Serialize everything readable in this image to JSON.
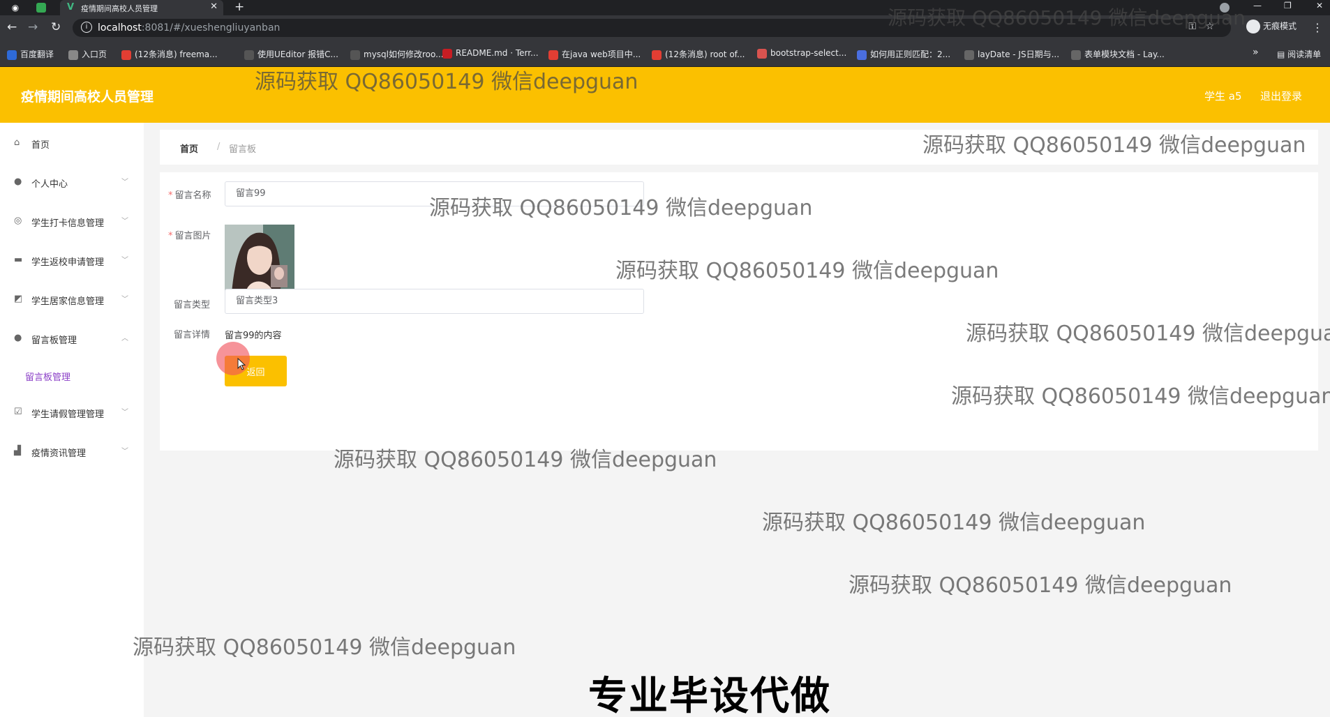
{
  "browser": {
    "tab_title": "疫情期间高校人员管理",
    "url_host": "localhost",
    "url_path": ":8081/#/xueshengliuyanban",
    "incognito_label": "无痕模式",
    "bookmarks": [
      {
        "label": "百度翻译",
        "icon": "translate-icon",
        "color": "#2e6ad8"
      },
      {
        "label": "入口页",
        "icon": "globe-icon",
        "color": "#888888"
      },
      {
        "label": "(12条消息) freema...",
        "icon": "csdn-icon",
        "color": "#e33e33"
      },
      {
        "label": "使用UEditor 报错C...",
        "icon": "doc-icon",
        "color": "#555555"
      },
      {
        "label": "mysql如何修改roo...",
        "icon": "doc-icon",
        "color": "#555555"
      },
      {
        "label": "README.md · Terr...",
        "icon": "gitee-icon",
        "color": "#c71d23"
      },
      {
        "label": "在java web项目中...",
        "icon": "csdn-icon",
        "color": "#e33e33"
      },
      {
        "label": "(12条消息) root of...",
        "icon": "csdn-icon",
        "color": "#e33e33"
      },
      {
        "label": "bootstrap-select...",
        "icon": "bookmark-icon",
        "color": "#d9534f"
      },
      {
        "label": "如何用正则匹配：2...",
        "icon": "bookmark-icon",
        "color": "#4a6ee0"
      },
      {
        "label": "layDate - JS日期与...",
        "icon": "layui-icon",
        "color": "#666666"
      },
      {
        "label": "表单模块文档 - Lay...",
        "icon": "layui-icon",
        "color": "#666666"
      }
    ],
    "reading_list": "阅读清单"
  },
  "header": {
    "title": "疫情期间高校人员管理",
    "user": "学生 a5",
    "logout": "退出登录",
    "bg_color": "#fbc000"
  },
  "sidebar": {
    "items": [
      {
        "label": "首页",
        "icon": "home-icon",
        "arrow": ""
      },
      {
        "label": "个人中心",
        "icon": "user-icon",
        "arrow": "chevron-down-icon"
      },
      {
        "label": "学生打卡信息管理",
        "icon": "target-icon",
        "arrow": "chevron-down-icon"
      },
      {
        "label": "学生返校申请管理",
        "icon": "briefcase-icon",
        "arrow": "chevron-down-icon"
      },
      {
        "label": "学生居家信息管理",
        "icon": "chart-icon",
        "arrow": "chevron-down-icon"
      },
      {
        "label": "留言板管理",
        "icon": "bulb-icon",
        "arrow": "chevron-up-icon"
      },
      {
        "label": "学生请假管理管理",
        "icon": "clipboard-icon",
        "arrow": "chevron-down-icon"
      },
      {
        "label": "疫情资讯管理",
        "icon": "news-icon",
        "arrow": "chevron-down-icon"
      }
    ],
    "submenu": {
      "label": "留言板管理"
    },
    "active_color": "#8b3fc7"
  },
  "breadcrumb": {
    "home": "首页",
    "separator": "/",
    "current": "留言板"
  },
  "form": {
    "name_label": "留言名称",
    "name_value": "留言99",
    "image_label": "留言图片",
    "type_label": "留言类型",
    "type_value": "留言类型3",
    "detail_label": "留言详情",
    "detail_value": "留言99的内容",
    "back_button": "返回"
  },
  "overlay": {
    "watermark": "源码获取 QQ86050149 微信deepguan",
    "promo": "专业毕设代做"
  }
}
